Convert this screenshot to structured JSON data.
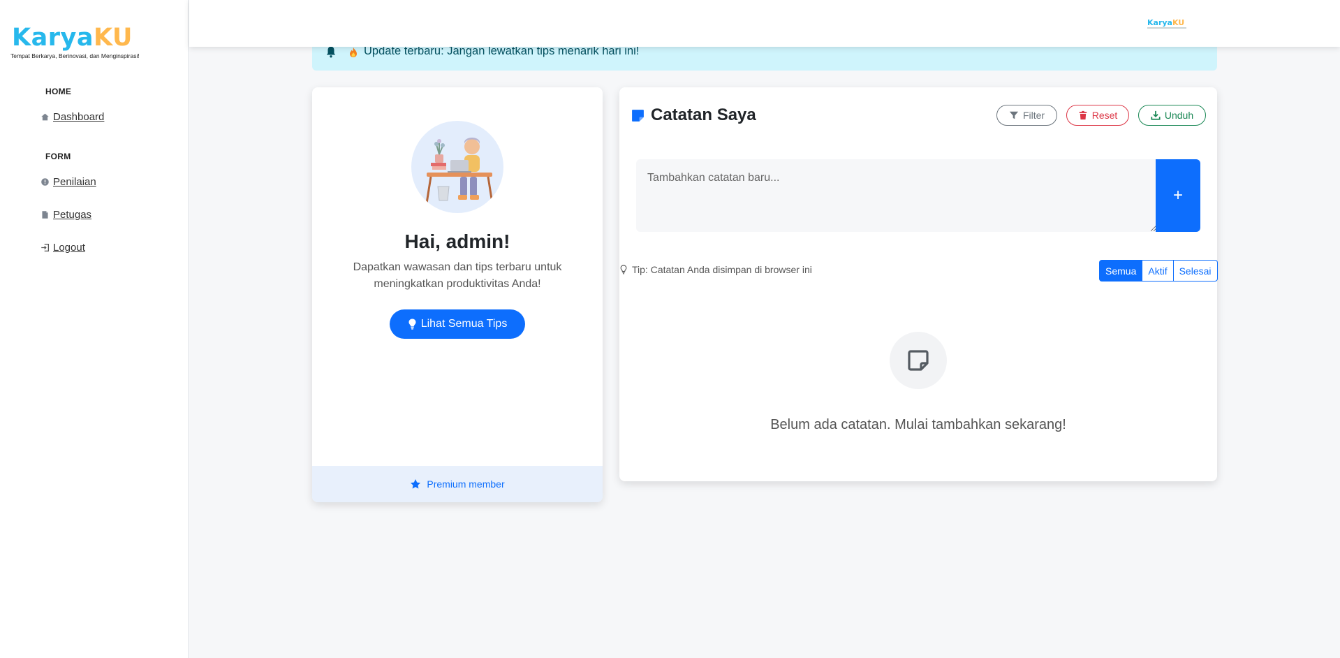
{
  "brand": {
    "name_part1": "Karya",
    "name_part2": "KU",
    "tagline": "Tempat Berkarya, Berinovasi, dan Menginspirasi!"
  },
  "sidebar": {
    "sections": [
      {
        "heading": "HOME",
        "items": [
          {
            "label": "Dashboard",
            "icon": "home-icon"
          }
        ]
      },
      {
        "heading": "FORM",
        "items": [
          {
            "label": "Penilaian",
            "icon": "info-circle-icon"
          },
          {
            "label": "Petugas",
            "icon": "document-icon"
          },
          {
            "label": "Logout",
            "icon": "logout-icon"
          }
        ]
      }
    ]
  },
  "alert": {
    "text": "Update terbaru: Jangan lewatkan tips menarik hari ini!",
    "icons": [
      "bell-icon",
      "fire-icon"
    ]
  },
  "profile": {
    "greeting": "Hai, admin!",
    "description": "Dapatkan wawasan dan tips terbaru untuk meningkatkan produktivitas Anda!",
    "button_label": "Lihat Semua Tips",
    "footer_label": "Premium member"
  },
  "notes": {
    "title": "Catatan Saya",
    "filter_label": "Filter",
    "reset_label": "Reset",
    "download_label": "Unduh",
    "input_placeholder": "Tambahkan catatan baru...",
    "add_label": "+",
    "tip": "Tip: Catatan Anda disimpan di browser ini",
    "filters": [
      "Semua",
      "Aktif",
      "Selesai"
    ],
    "active_filter": "Semua",
    "empty_message": "Belum ada catatan. Mulai tambahkan sekarang!"
  },
  "colors": {
    "primary": "#0d6efd",
    "logo_blue": "#27b8ec",
    "logo_orange": "#ffb84d",
    "alert_bg": "#cff4fc",
    "danger": "#dc3545",
    "success": "#198754"
  }
}
